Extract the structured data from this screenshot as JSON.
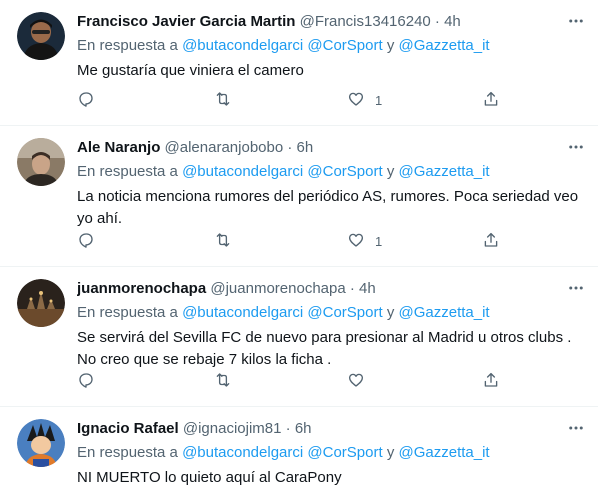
{
  "tweets": [
    {
      "name": "Francisco Javier Garcia Martin",
      "handle": "@Francis13416240",
      "dot": "·",
      "time": "4h",
      "reply_prefix": "En respuesta a",
      "mention1": "@butacondelgarci",
      "mention2": "@CorSport",
      "conj": "y",
      "mention3": "@Gazzetta_it",
      "text": "Me gustaría que viniera el camero",
      "like_count": "1",
      "avatar_color": "#1b2a3a"
    },
    {
      "name": "Ale Naranjo",
      "handle": "@alenaranjobobo",
      "dot": "·",
      "time": "6h",
      "reply_prefix": "En respuesta a",
      "mention1": "@butacondelgarci",
      "mention2": "@CorSport",
      "conj": "y",
      "mention3": "@Gazzetta_it",
      "text": "La noticia menciona rumores del periódico AS, rumores. Poca seriedad veo yo ahí.",
      "like_count": "1",
      "avatar_color": "#7a6a58"
    },
    {
      "name": "juanmorenochapa",
      "handle": "@juanmorenochapa",
      "dot": "·",
      "time": "4h",
      "reply_prefix": "En respuesta a",
      "mention1": "@butacondelgarci",
      "mention2": "@CorSport",
      "conj": "y",
      "mention3": "@Gazzetta_it",
      "text": "Se servirá del Sevilla FC de nuevo para presionar al Madrid u otros clubs . No creo que se rebaje 7 kilos la ficha .",
      "like_count": "",
      "avatar_color": "#3a2f26"
    },
    {
      "name": "Ignacio Rafael",
      "handle": "@ignaciojim81",
      "dot": "·",
      "time": "6h",
      "reply_prefix": "En respuesta a",
      "mention1": "@butacondelgarci",
      "mention2": "@CorSport",
      "conj": "y",
      "mention3": "@Gazzetta_it",
      "text": "NI MUERTO lo quieto aquí al CaraPony",
      "like_count": "",
      "avatar_color": "#4a7fc0"
    }
  ],
  "colors": {
    "link": "#1d9bf0",
    "secondary_text": "#536471",
    "primary_text": "#0f1419",
    "divider": "#eff3f4"
  },
  "icons": [
    "reply-icon",
    "retweet-icon",
    "like-icon",
    "share-icon",
    "more-options-icon"
  ]
}
